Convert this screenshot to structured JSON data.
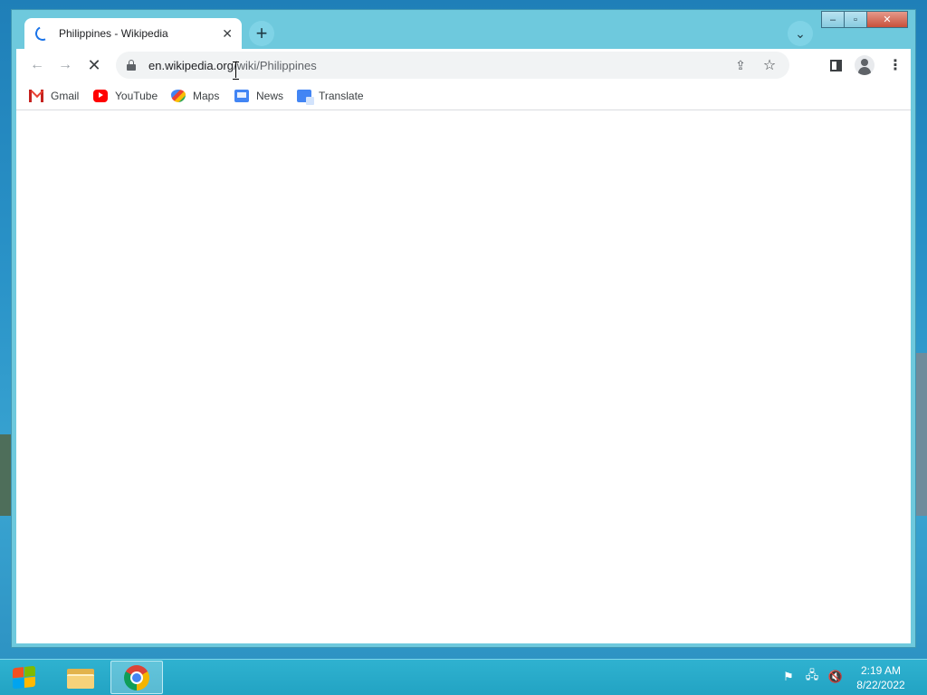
{
  "browser": {
    "tab": {
      "title": "Philippines - Wikipedia",
      "close_glyph": "✕"
    },
    "new_tab_glyph": "+",
    "tab_search_glyph": "⌄",
    "toolbar": {
      "back_glyph": "←",
      "forward_glyph": "→",
      "stop_glyph": "✕",
      "url_host": "en.wikipedia.org",
      "url_path": "/wiki/Philippines",
      "share_glyph": "⇪",
      "star_glyph": "☆",
      "menu_glyph": "⋮"
    },
    "bookmarks": [
      {
        "label": "Gmail",
        "icon": "gmail-icon"
      },
      {
        "label": "YouTube",
        "icon": "youtube-icon"
      },
      {
        "label": "Maps",
        "icon": "maps-icon"
      },
      {
        "label": "News",
        "icon": "news-icon"
      },
      {
        "label": "Translate",
        "icon": "translate-icon"
      }
    ],
    "window_controls": {
      "minimize": "–",
      "maximize": "▫",
      "close": "✕"
    }
  },
  "taskbar": {
    "apps": [
      {
        "name": "File Explorer",
        "icon": "folder-icon"
      },
      {
        "name": "Google Chrome",
        "icon": "chrome-icon",
        "active": true
      }
    ],
    "tray": {
      "flag_glyph": "⚑",
      "network_glyph": "🖧",
      "volume_glyph": "🔇"
    },
    "clock": {
      "time": "2:19 AM",
      "date": "8/22/2022"
    }
  },
  "colors": {
    "accent": "#1a73e8",
    "frame": "#6ec9dd",
    "taskbar": "#22a3c3",
    "close_button": "#c9503a"
  }
}
